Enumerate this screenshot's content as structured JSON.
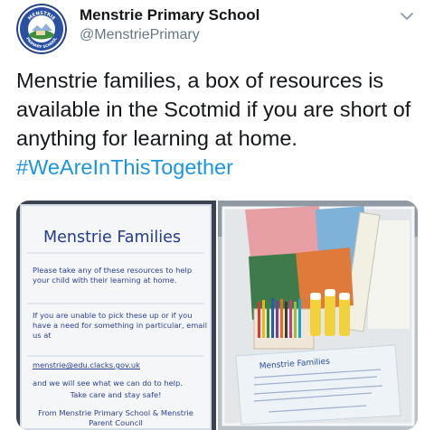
{
  "account": {
    "name": "Menstrie Primary School",
    "handle": "@MenstriePrimary",
    "avatar_top_text": "MENSTRIE",
    "avatar_bottom_text": "PRIMARY SCHOOL"
  },
  "tweet": {
    "text": "Menstrie families, a box of resources is available in the Scotmid if you are short of anything for learning at home.",
    "hashtag": "#WeAreInThisTogether"
  },
  "poster": {
    "title": "Menstrie Families",
    "para1": "Please take any of these resources to help your child with their learning at home.",
    "para2": "If you are unable to pick these up or if you have a need for something in particular, email us at",
    "email": "menstrie@edu.clacks.gov.uk",
    "para3": "and we will see what we can do to help.",
    "para4": "Take care and stay safe!",
    "footer1": "From Menstrie Primary School & Menstrie",
    "footer2": "Parent Council"
  },
  "box_poster": {
    "title": "Menstrie Families"
  },
  "icons": {
    "more": "chevron-down-icon"
  },
  "colors": {
    "hashtag": "#1b95e0",
    "handle": "#657786",
    "poster_text": "#2b3f8f"
  }
}
